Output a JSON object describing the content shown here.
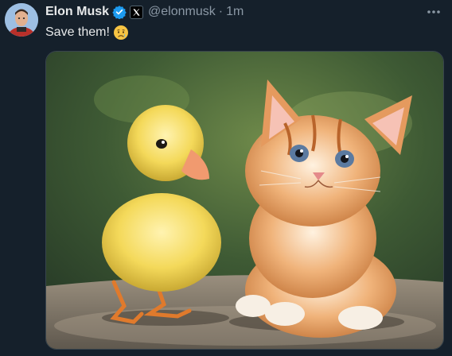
{
  "author": {
    "display_name": "Elon Musk",
    "handle": "@elonmusk",
    "separator": "·",
    "time_ago": "1m",
    "verified_icon": "verified-badge-icon",
    "affiliate_icon": "x-logo-icon"
  },
  "tweet": {
    "text": "Save them!",
    "emoji": "crying-face-icon"
  },
  "actions": {
    "more_icon": "more-options-icon"
  },
  "colors": {
    "background": "#15202b",
    "text_primary": "#e7e9ea",
    "text_secondary": "#8b98a5",
    "verified_blue": "#1d9bf0"
  }
}
